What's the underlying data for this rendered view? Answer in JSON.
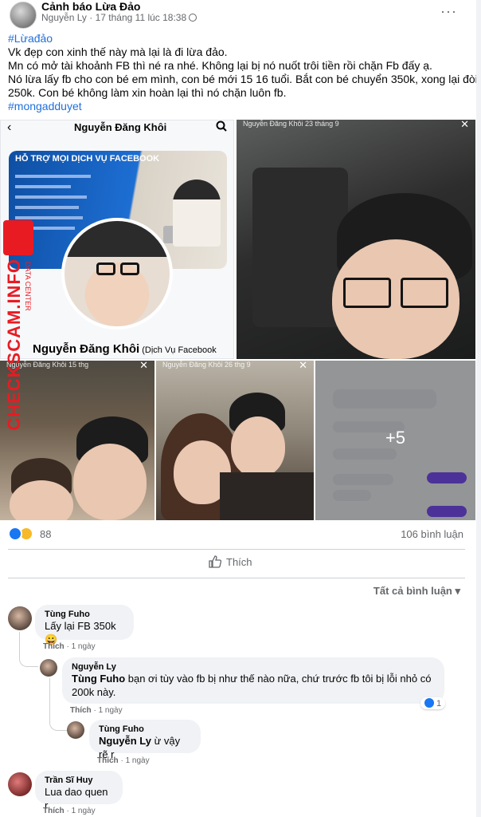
{
  "post": {
    "group_name": "Cảnh báo Lừa Đảo",
    "author": "Nguyễn Ly",
    "time": "17 tháng 11 lúc 18:38",
    "separator": " · ",
    "more": "···",
    "hashtag1": "#Lừađảo",
    "lines": [
      "Vk đẹp con xinh thế này mà lại là đi lừa đảo.",
      "Mn có mở tài khoảnh FB thì né ra nhé. Không lại bị nó nuốt trôi tiền rồi chặn Fb đấy ạ.",
      "Nó lừa lấy fb cho con bé em mình, con bé mới 15 16 tuổi. Bắt con bé chuyển 350k, xong lại đòi",
      "250k. Con bé không làm xin hoàn lại thì nó chặn luôn fb."
    ],
    "hashtag2": "#mongadduyet"
  },
  "photos": {
    "p1_title": "Nguyễn Đăng Khôi",
    "p1_cover_title": "HỖ TRỢ MỌI DỊCH VỤ FACEBOOK",
    "p1_profile_name": "Nguyễn Đăng Khôi",
    "p1_profile_sub": " (Dịch Vụ Facebook",
    "p2_story_head": "Nguyễn Đăng Khôi 23 tháng 9",
    "p3_story_head": "Nguyễn Đăng Khôi 15 thg",
    "p4_story_head": "Nguyễn Đăng Khôi 26 thg 9",
    "more_count": "+5"
  },
  "watermark": {
    "text": "CHECKSCAM.INFO",
    "sub": "DATA CENTER"
  },
  "stats": {
    "reaction_count": "88",
    "comment_count": "106 bình luận"
  },
  "actions": {
    "like": "Thích",
    "sort": "Tất cả bình luận ▾"
  },
  "comments": [
    {
      "name": "Tùng Fuho",
      "text": "Lấy lại FB 350k 😀",
      "like": "Thích",
      "time": "1 ngày"
    },
    {
      "name": "Nguyễn Ly",
      "mention": "Tùng Fuho",
      "text": " bạn ơi tùy vào fb bị như thế nào nữa, chứ trước fb tôi bị lỗi nhỏ có",
      "text2": "200k này.",
      "like": "Thích",
      "time": "1 ngày",
      "reactions": "1"
    },
    {
      "name": "Tùng Fuho",
      "mention": "Nguyễn Ly",
      "text": " ừ vậy rẽ r",
      "like": "Thích",
      "time": "1 ngày"
    },
    {
      "name": "Trần Sĩ Huy",
      "text": "Lua dao quen r",
      "like": "Thích",
      "time": "1 ngày"
    }
  ],
  "colors": {
    "hashtag": "#216fdb",
    "like_blue": "#1877f2",
    "watermark_red": "#e81b23"
  }
}
